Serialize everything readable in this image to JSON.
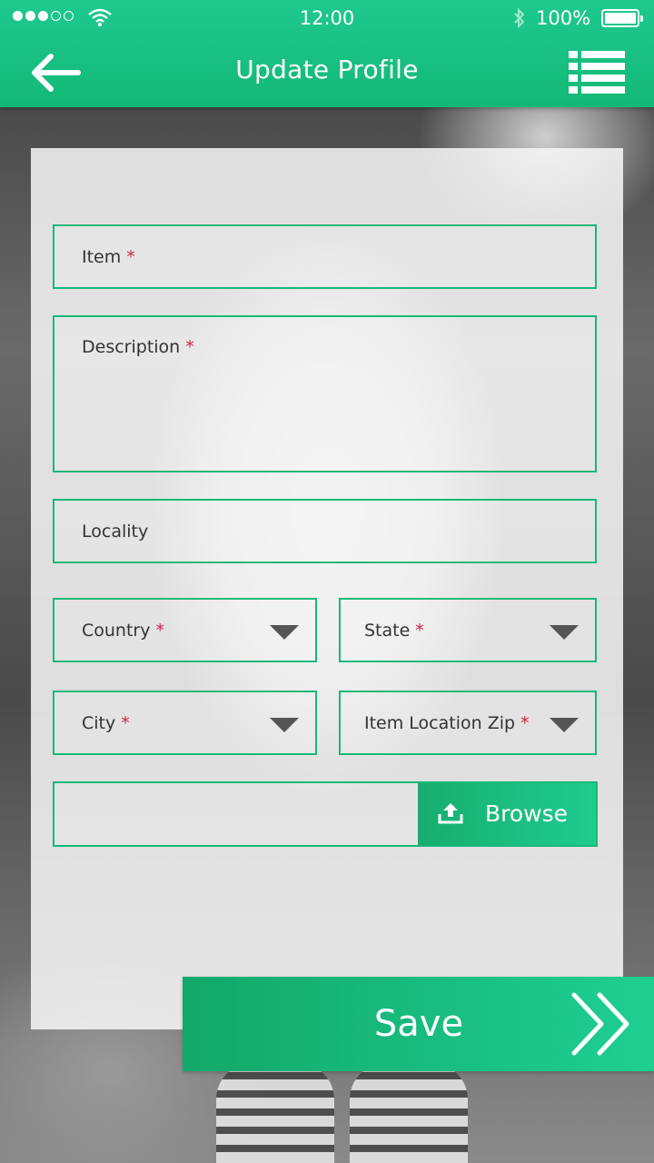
{
  "status_bar": {
    "time": "12:00",
    "battery": "100%"
  },
  "header": {
    "title": "Update Profile"
  },
  "form": {
    "item_label": "Item",
    "description_label": "Description",
    "locality_label": "Locality",
    "country_label": "Country",
    "state_label": "State",
    "city_label": "City",
    "zip_label": "Item Location Zip",
    "required_marker": "*",
    "browse_label": "Browse"
  },
  "save_label": "Save",
  "colors": {
    "accent": "#17b87a",
    "required": "#d0214a"
  },
  "icons": [
    "back-arrow-icon",
    "list-menu-icon",
    "upload-icon",
    "dropdown-caret-icon",
    "double-chevron-right-icon",
    "wifi-icon",
    "bluetooth-icon",
    "battery-icon"
  ]
}
